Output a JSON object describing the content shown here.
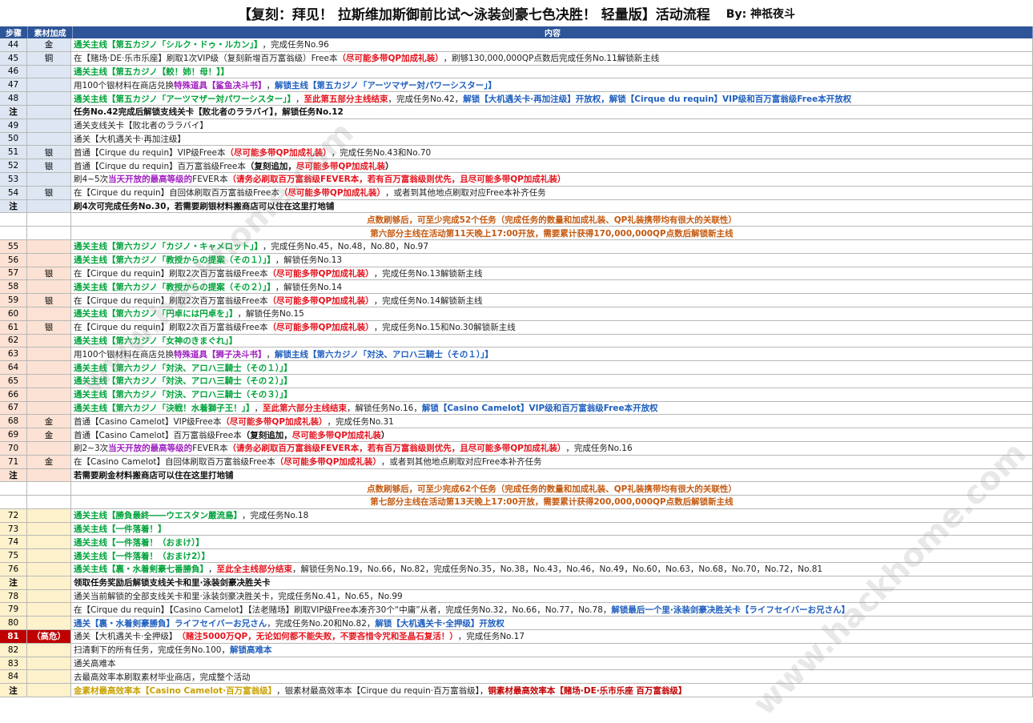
{
  "title": "【复刻：拜见！ 拉斯维加斯御前比试～泳装剑豪七色决胜！ 轻量版】活动流程",
  "byline": "By: 神祇夜斗",
  "headers": {
    "step": "步骤",
    "bonus": "素材加成",
    "content": "内容"
  },
  "watermark": "www.hackhome.com",
  "colors": {
    "header": "#2e5597",
    "green": "#00a33a",
    "red": "#e5141e",
    "blue": "#1f5fbf",
    "purple": "#a020c0",
    "orange": "#c55a11"
  },
  "rows": [
    {
      "step": "44",
      "bonus": "金",
      "group": "blue",
      "parts": [
        {
          "t": "通关主线【第五カジノ「シルク・ドゥ・ルカン」】",
          "s": "g"
        },
        {
          "t": "，完成任务No.96",
          "s": "k"
        }
      ]
    },
    {
      "step": "45",
      "bonus": "铜",
      "group": "blue",
      "parts": [
        {
          "t": "在【赌场·DE·乐市乐座】刷取1次VIP级（复刻新增百万富翁级）Free本",
          "s": "k"
        },
        {
          "t": "（尽可能多带QP加成礼装）",
          "s": "r"
        },
        {
          "t": "，刷够130,000,000QP点数后完成任务No.11解锁新主线",
          "s": "k"
        }
      ]
    },
    {
      "step": "46",
      "bonus": "",
      "group": "blue",
      "parts": [
        {
          "t": "通关主线【第五カジノ【鲛！姉！母！】】",
          "s": "g"
        }
      ]
    },
    {
      "step": "47",
      "bonus": "",
      "group": "blue",
      "parts": [
        {
          "t": "用100个银材料在商店兑换",
          "s": "k"
        },
        {
          "t": "特殊道具【鲨鱼决斗书】",
          "s": "p"
        },
        {
          "t": "，",
          "s": "k"
        },
        {
          "t": "解锁主线【第五カジノ「アーツマザー対パワーシスター」】",
          "s": "b"
        }
      ]
    },
    {
      "step": "48",
      "bonus": "",
      "group": "blue",
      "parts": [
        {
          "t": "通关主线【第五カジノ「アーツマザー対パワーシスター」】",
          "s": "g"
        },
        {
          "t": "，",
          "s": "k"
        },
        {
          "t": "至此第五部分主线结束",
          "s": "r"
        },
        {
          "t": "，完成任务No.42，",
          "s": "k"
        },
        {
          "t": "解锁【大机遇关卡·再加注级】开放权，解锁【Cirque du requin】VIP级和百万富翁级Free本开放权",
          "s": "b"
        }
      ]
    },
    {
      "step": "注",
      "bonus": "",
      "group": "blue",
      "note": true,
      "bold": true,
      "parts": [
        {
          "t": "任务No.42完成后解锁支线关卡【败北者のララバイ】，解锁任务No.12",
          "s": "kb"
        }
      ]
    },
    {
      "step": "49",
      "bonus": "",
      "group": "blue",
      "parts": [
        {
          "t": "通关支线关卡【败北者のララバイ】",
          "s": "k"
        }
      ]
    },
    {
      "step": "50",
      "bonus": "",
      "group": "blue",
      "parts": [
        {
          "t": "通关【大机遇关卡·再加注级】",
          "s": "k"
        }
      ]
    },
    {
      "step": "51",
      "bonus": "银",
      "group": "blue",
      "parts": [
        {
          "t": "首通【Cirque du requin】VIP级Free本",
          "s": "k"
        },
        {
          "t": "（尽可能多带QP加成礼装）",
          "s": "r"
        },
        {
          "t": "，完成任务No.43和No.70",
          "s": "k"
        }
      ]
    },
    {
      "step": "52",
      "bonus": "银",
      "group": "blue",
      "parts": [
        {
          "t": "首通【Cirque du requin】百万富翁级Free本",
          "s": "k"
        },
        {
          "t": "（复刻追加，",
          "s": "kb"
        },
        {
          "t": "尽可能多带QP加成礼装",
          "s": "r"
        },
        {
          "t": "）",
          "s": "kb"
        }
      ]
    },
    {
      "step": "53",
      "bonus": "",
      "group": "blue",
      "parts": [
        {
          "t": "刷4~5次",
          "s": "k"
        },
        {
          "t": "当天开放的最高等级的",
          "s": "p"
        },
        {
          "t": "FEVER本",
          "s": "k"
        },
        {
          "t": "（请务必刷取百万富翁级FEVER本，若有百万富翁级则优先，且尽可能多带QP加成礼装）",
          "s": "r"
        }
      ]
    },
    {
      "step": "54",
      "bonus": "银",
      "group": "blue",
      "parts": [
        {
          "t": "在【Cirque du requin】自回体刷取百万富翁级Free本",
          "s": "k"
        },
        {
          "t": "（尽可能多带QP加成礼装）",
          "s": "r"
        },
        {
          "t": "，或者到其他地点刷取对应Free本补齐任务",
          "s": "k"
        }
      ]
    },
    {
      "step": "注",
      "bonus": "",
      "group": "blue",
      "note": true,
      "bold": true,
      "parts": [
        {
          "t": "刷4次可完成任务No.30，若需要刷银材料搬商店可以住在这里打地铺",
          "s": "kb"
        }
      ]
    },
    {
      "step": "",
      "bonus": "",
      "group": "none",
      "center": true,
      "parts": [
        {
          "t": "点数刷够后，可至少完成52个任务（完成任务的数量和加成礼装、QP礼装携带均有很大的关联性）",
          "s": "o"
        }
      ]
    },
    {
      "step": "",
      "bonus": "",
      "group": "none",
      "center": true,
      "parts": [
        {
          "t": "第六部分主线在活动第11天晚上17:00开放，需要累计获得170,000,000QP点数后解锁新主线",
          "s": "o"
        }
      ]
    },
    {
      "step": "55",
      "bonus": "",
      "group": "orange",
      "parts": [
        {
          "t": "通关主线【第六カジノ「カジノ・キャメロット」】",
          "s": "g"
        },
        {
          "t": "，完成任务No.45，No.48，No.80，No.97",
          "s": "k"
        }
      ]
    },
    {
      "step": "56",
      "bonus": "",
      "group": "orange",
      "parts": [
        {
          "t": "通关主线【第六カジノ「教授からの提案（その１）」】",
          "s": "g"
        },
        {
          "t": "，解锁任务No.13",
          "s": "k"
        }
      ]
    },
    {
      "step": "57",
      "bonus": "银",
      "group": "orange",
      "parts": [
        {
          "t": "在【Cirque du requin】刷取2次百万富翁级Free本",
          "s": "k"
        },
        {
          "t": "（尽可能多带QP加成礼装）",
          "s": "r"
        },
        {
          "t": "，完成任务No.13解锁新主线",
          "s": "k"
        }
      ]
    },
    {
      "step": "58",
      "bonus": "",
      "group": "orange",
      "parts": [
        {
          "t": "通关主线【第六カジノ「教授からの提案（その２）」】",
          "s": "g"
        },
        {
          "t": "，解锁任务No.14",
          "s": "k"
        }
      ]
    },
    {
      "step": "59",
      "bonus": "银",
      "group": "orange",
      "parts": [
        {
          "t": "在【Cirque du requin】刷取2次百万富翁级Free本",
          "s": "k"
        },
        {
          "t": "（尽可能多带QP加成礼装）",
          "s": "r"
        },
        {
          "t": "，完成任务No.14解锁新主线",
          "s": "k"
        }
      ]
    },
    {
      "step": "60",
      "bonus": "",
      "group": "orange",
      "parts": [
        {
          "t": "通关主线【第六カジノ「円卓には円卓を」】",
          "s": "g"
        },
        {
          "t": "，解锁任务No.15",
          "s": "k"
        }
      ]
    },
    {
      "step": "61",
      "bonus": "银",
      "group": "orange",
      "parts": [
        {
          "t": "在【Cirque du requin】刷取2次百万富翁级Free本",
          "s": "k"
        },
        {
          "t": "（尽可能多带QP加成礼装）",
          "s": "r"
        },
        {
          "t": "，完成任务No.15和No.30解锁新主线",
          "s": "k"
        }
      ]
    },
    {
      "step": "62",
      "bonus": "",
      "group": "orange",
      "parts": [
        {
          "t": "通关主线【第六カジノ「女神のきまぐれ」】",
          "s": "g"
        }
      ]
    },
    {
      "step": "63",
      "bonus": "",
      "group": "orange",
      "parts": [
        {
          "t": "用100个银材料在商店兑换",
          "s": "k"
        },
        {
          "t": "特殊道具【狮子决斗书】",
          "s": "p"
        },
        {
          "t": "，",
          "s": "k"
        },
        {
          "t": "解锁主线【第六カジノ「対決、アロハ三騎士（その１）」】",
          "s": "b"
        }
      ]
    },
    {
      "step": "64",
      "bonus": "",
      "group": "orange",
      "parts": [
        {
          "t": "通关主线【第六カジノ「対決、アロハ三騎士（その１）」】",
          "s": "g"
        }
      ]
    },
    {
      "step": "65",
      "bonus": "",
      "group": "orange",
      "parts": [
        {
          "t": "通关主线【第六カジノ「対決、アロハ三騎士（その２）」】",
          "s": "g"
        }
      ]
    },
    {
      "step": "66",
      "bonus": "",
      "group": "orange",
      "parts": [
        {
          "t": "通关主线【第六カジノ「対決、アロハ三騎士（その３）」】",
          "s": "g"
        }
      ]
    },
    {
      "step": "67",
      "bonus": "",
      "group": "orange",
      "parts": [
        {
          "t": "通关主线【第六カジノ「決戦！水着獅子王！」】",
          "s": "g"
        },
        {
          "t": "，",
          "s": "k"
        },
        {
          "t": "至此第六部分主线结束",
          "s": "r"
        },
        {
          "t": "，解锁任务No.16，",
          "s": "k"
        },
        {
          "t": "解锁【Casino Camelot】VIP级和百万富翁级Free本开放权",
          "s": "b"
        }
      ]
    },
    {
      "step": "68",
      "bonus": "金",
      "group": "orange",
      "parts": [
        {
          "t": "首通【Casino Camelot】VIP级Free本",
          "s": "k"
        },
        {
          "t": "（尽可能多带QP加成礼装）",
          "s": "r"
        },
        {
          "t": "，完成任务No.31",
          "s": "k"
        }
      ]
    },
    {
      "step": "69",
      "bonus": "金",
      "group": "orange",
      "parts": [
        {
          "t": "首通【Casino Camelot】百万富翁级Free本",
          "s": "k"
        },
        {
          "t": "（复刻追加，",
          "s": "kb"
        },
        {
          "t": "尽可能多带QP加成礼装",
          "s": "r"
        },
        {
          "t": "）",
          "s": "kb"
        }
      ]
    },
    {
      "step": "70",
      "bonus": "",
      "group": "orange",
      "parts": [
        {
          "t": "刷2~3次",
          "s": "k"
        },
        {
          "t": "当天开放的最高等级的",
          "s": "p"
        },
        {
          "t": "FEVER本",
          "s": "k"
        },
        {
          "t": "（请务必刷取百万富翁级FEVER本，若有百万富翁级则优先，且尽可能多带QP加成礼装）",
          "s": "r"
        },
        {
          "t": "，完成任务No.16",
          "s": "k"
        }
      ]
    },
    {
      "step": "71",
      "bonus": "金",
      "group": "orange",
      "parts": [
        {
          "t": "在【Casino Camelot】自回体刷取百万富翁级Free本",
          "s": "k"
        },
        {
          "t": "（尽可能多带QP加成礼装）",
          "s": "r"
        },
        {
          "t": "，或者到其他地点刷取对应Free本补齐任务",
          "s": "k"
        }
      ]
    },
    {
      "step": "注",
      "bonus": "",
      "group": "orange",
      "note": true,
      "bold": true,
      "parts": [
        {
          "t": "若需要刷金材料搬商店可以住在这里打地铺",
          "s": "kb"
        }
      ]
    },
    {
      "step": "",
      "bonus": "",
      "group": "none",
      "center": true,
      "parts": [
        {
          "t": "点数刷够后，可至少完成62个任务（完成任务的数量和加成礼装、QP礼装携带均有很大的关联性）",
          "s": "o"
        }
      ]
    },
    {
      "step": "",
      "bonus": "",
      "group": "none",
      "center": true,
      "parts": [
        {
          "t": "第七部分主线在活动第13天晚上17:00开放，需要累计获得200,000,000QP点数后解锁新主线",
          "s": "o"
        }
      ]
    },
    {
      "step": "72",
      "bonus": "",
      "group": "yellow",
      "parts": [
        {
          "t": "通关主线【勝負最終――ウエスタン嚴流島】",
          "s": "g"
        },
        {
          "t": "，完成任务No.18",
          "s": "k"
        }
      ]
    },
    {
      "step": "73",
      "bonus": "",
      "group": "yellow",
      "parts": [
        {
          "t": "通关主线【一件落着！】",
          "s": "g"
        }
      ]
    },
    {
      "step": "74",
      "bonus": "",
      "group": "yellow",
      "parts": [
        {
          "t": "通关主线【一件落着！（おまけ）】",
          "s": "g"
        }
      ]
    },
    {
      "step": "75",
      "bonus": "",
      "group": "yellow",
      "parts": [
        {
          "t": "通关主线【一件落着！（おまけ2）】",
          "s": "g"
        }
      ]
    },
    {
      "step": "76",
      "bonus": "",
      "group": "yellow",
      "parts": [
        {
          "t": "通关主线【裏・水着剣豪七番勝負】",
          "s": "g"
        },
        {
          "t": "，",
          "s": "k"
        },
        {
          "t": "至此全主线部分结束",
          "s": "r"
        },
        {
          "t": "，解锁任务No.19，No.66，No.82，完成任务No.35，No.38，No.43，No.46，No.49，No.60，No.63，No.68，No.70，No.72，No.81",
          "s": "k"
        }
      ]
    },
    {
      "step": "注",
      "bonus": "",
      "group": "yellow",
      "note": true,
      "bold": true,
      "parts": [
        {
          "t": "领取任务奖励后解锁支线关卡和里·泳装剑豪决胜关卡",
          "s": "kb"
        }
      ]
    },
    {
      "step": "78",
      "bonus": "",
      "group": "yellow",
      "parts": [
        {
          "t": "通关当前解锁的全部支线关卡和里·泳装剑豪决胜关卡，完成任务No.41，No.65，No.99",
          "s": "k"
        }
      ]
    },
    {
      "step": "79",
      "bonus": "",
      "group": "yellow",
      "parts": [
        {
          "t": "在【Cirque du requin】【Casino Camelot】【法老赌场】刷取VIP级Free本凑齐30个“中庸”从者，完成任务No.32，No.66，No.77，No.78，",
          "s": "k"
        },
        {
          "t": "解锁最后一个里·泳装剑豪决胜关卡【ライフセイバーお兄さん】",
          "s": "b"
        }
      ]
    },
    {
      "step": "80",
      "bonus": "",
      "group": "yellow",
      "parts": [
        {
          "t": "通关【裏・水着剣豪勝負】ライフセイバーお兄さん",
          "s": "b"
        },
        {
          "t": "，完成任务No.20和No.82，",
          "s": "k"
        },
        {
          "t": "解锁【大机遇关卡·全押级】开放权",
          "s": "b"
        }
      ]
    },
    {
      "step": "81",
      "bonus": "（高危）",
      "group": "yellow",
      "danger": true,
      "parts": [
        {
          "t": "通关【大机遇关卡·全押级】",
          "s": "k"
        },
        {
          "t": "（赌注5000万QP，无论如何都不能失败，不要吝惜令咒和圣晶石复活！）",
          "s": "r"
        },
        {
          "t": "，完成任务No.17",
          "s": "k"
        }
      ]
    },
    {
      "step": "82",
      "bonus": "",
      "group": "yellow",
      "parts": [
        {
          "t": "扫清剩下的所有任务，完成任务No.100，",
          "s": "k"
        },
        {
          "t": "解锁高难本",
          "s": "b"
        }
      ]
    },
    {
      "step": "83",
      "bonus": "",
      "group": "yellow",
      "parts": [
        {
          "t": "通关高难本",
          "s": "k"
        }
      ]
    },
    {
      "step": "84",
      "bonus": "",
      "group": "yellow",
      "parts": [
        {
          "t": "去最高效率本刷取素材毕业商店，完成整个活动",
          "s": "k"
        }
      ]
    },
    {
      "step": "注",
      "bonus": "",
      "group": "yellow",
      "note": true,
      "parts": [
        {
          "t": "金素材最高效率本【Casino Camelot·百万富翁级】",
          "s": "y"
        },
        {
          "t": "，银素材最高效率本【Cirque du requin·百万富翁级】，",
          "s": "k"
        },
        {
          "t": "铜素材最高效率本【赌场·DE·乐市乐座 百万富翁级】",
          "s": "w"
        }
      ]
    }
  ]
}
